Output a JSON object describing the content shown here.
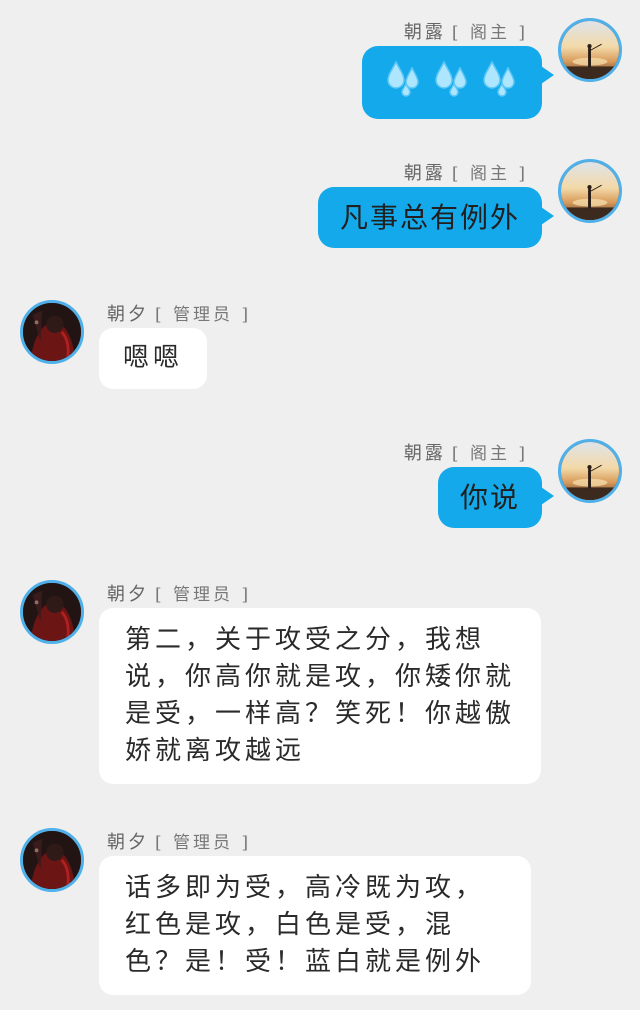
{
  "messages": [
    {
      "side": "right",
      "sender": "朝露",
      "role": "[ 阁主 ]",
      "content": "",
      "icon": "sweat-drops-icon",
      "icon_count": 3
    },
    {
      "side": "right",
      "sender": "朝露",
      "role": "[ 阁主 ]",
      "content": "凡事总有例外"
    },
    {
      "side": "left",
      "sender": "朝夕",
      "role": "[ 管理员 ]",
      "content": "嗯嗯"
    },
    {
      "side": "right",
      "sender": "朝露",
      "role": "[ 阁主 ]",
      "content": "你说"
    },
    {
      "side": "left",
      "sender": "朝夕",
      "role": "[ 管理员 ]",
      "content": "第二，关于攻受之分，我想说，你高你就是攻，你矮你就是受，一样高？笑死！你越傲娇就离攻越远"
    },
    {
      "side": "left",
      "sender": "朝夕",
      "role": "[ 管理员 ]",
      "content": "话多即为受，高冷既为攻，红色是攻，白色是受，混色？是！受！蓝白就是例外"
    }
  ],
  "colors": {
    "background": "#efefef",
    "blue_bubble": "#14a9ea",
    "white_bubble": "#ffffff",
    "avatar_border": "#4fb0ea",
    "sender_text": "#666666"
  }
}
